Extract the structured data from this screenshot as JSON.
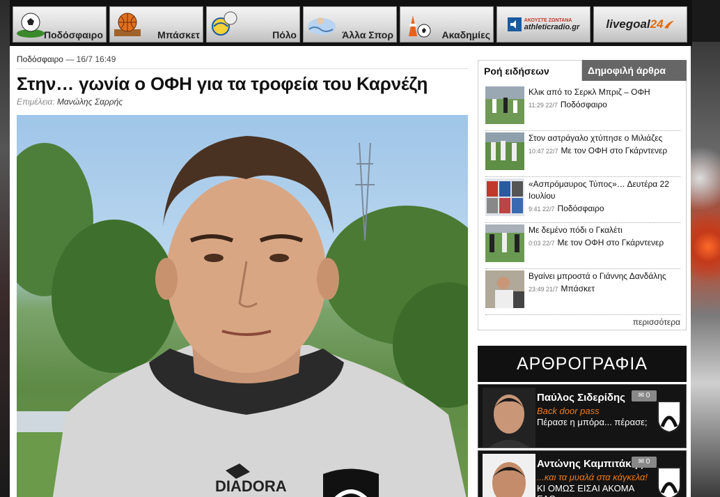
{
  "nav": {
    "items": [
      {
        "label": "Ποδόσφαιρο",
        "icon": "soccer-ball-icon"
      },
      {
        "label": "Μπάσκετ",
        "icon": "basketball-icon"
      },
      {
        "label": "Πόλο",
        "icon": "water-polo-ball-icon"
      },
      {
        "label": "Άλλα Σπορ",
        "icon": "swimmer-icon"
      },
      {
        "label": "Ακαδημίες",
        "icon": "training-cones-icon"
      }
    ],
    "radio_banner": {
      "top": "ΑΚΟΥΣΤΕ ΖΩΝΤΑΝΑ",
      "name": "athleticradio.gr"
    },
    "livegoal_banner": {
      "part1": "livegoal",
      "part2": "24"
    }
  },
  "article": {
    "category": "Ποδόσφαιρο",
    "date": "— 16/7 16:49",
    "title": "Στην… γωνία ο ΟΦΗ για τα τροφεία του Καρνέζη",
    "editor_label": "Επιμέλεια:",
    "editor_name": "Μανώλης Σαρρής",
    "photo_icon": "player-portrait-photo"
  },
  "sidebar": {
    "tab_active": "Ροή ειδήσεων",
    "tab_inactive": "Δημοφιλή άρθρα",
    "news": [
      {
        "title": "Κλικ από το Σερκλ Μπριζ – ΟΦΗ",
        "time": "11:29 22/7",
        "category": "Ποδόσφαιρο"
      },
      {
        "title": "Στον αστράγαλο χτύπησε ο Μιλιάζες",
        "time": "10:47 22/7",
        "category": "Με τον ΟΦΗ στο Γκάρντενερ"
      },
      {
        "title": "«Ασπρόμαυρος Τύπος»… Δευτέρα 22 Ιουλίου",
        "time": "9:41 22/7",
        "category": "Ποδόσφαιρο"
      },
      {
        "title": "Με δεμένο πόδι ο Γκαλέτι",
        "time": "0:03 22/7",
        "category": "Με τον ΟΦΗ στο Γκάρντενερ"
      },
      {
        "title": "Βγαίνει μπροστά ο Γιάννης Δανδάλης",
        "time": "23:49 21/7",
        "category": "Μπάσκετ"
      }
    ],
    "more": "περισσότερα"
  },
  "opinion": {
    "header": "ΑΡΘΡΟΓΡΑΦΙΑ",
    "authors": [
      {
        "name": "Παύλος Σιδερίδης",
        "column": "Back door pass",
        "snippet": "Πέρασε η μπόρα... πέρασε;",
        "comments": "0"
      },
      {
        "name": "Αντώνης Καμπιτάκης",
        "column": "...και τα μυαλά στα κάγκελα!",
        "snippet": "ΚΙ ΟΜΩΣ ΕΙΣΑΙ ΑΚΟΜΑ ΕΔΩ",
        "comments": "0"
      }
    ]
  },
  "colors": {
    "accent_orange": "#f07a1a",
    "nav_bg": "#111111",
    "tab_inactive_bg": "#666666"
  }
}
